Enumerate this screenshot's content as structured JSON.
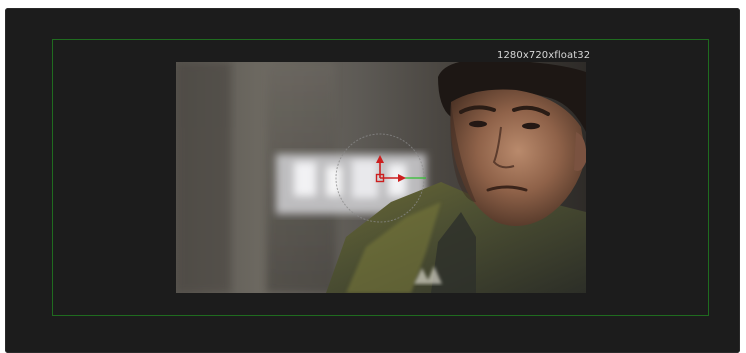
{
  "viewer": {
    "resolution_label": "1280x720xfloat32",
    "safe_area_color": "#1f6b1f",
    "background_color": "#1c1c1c"
  },
  "transform_widget": {
    "x_axis_color": "#cc1f1f",
    "y_axis_color": "#cc1f1f",
    "guide_line_color": "#2fbf2f",
    "ring_color": "#8a8a8a"
  },
  "icons": {
    "center-handle": "square-outline-icon",
    "x-axis-handle": "arrow-right-icon",
    "y-axis-handle": "arrow-up-icon"
  }
}
